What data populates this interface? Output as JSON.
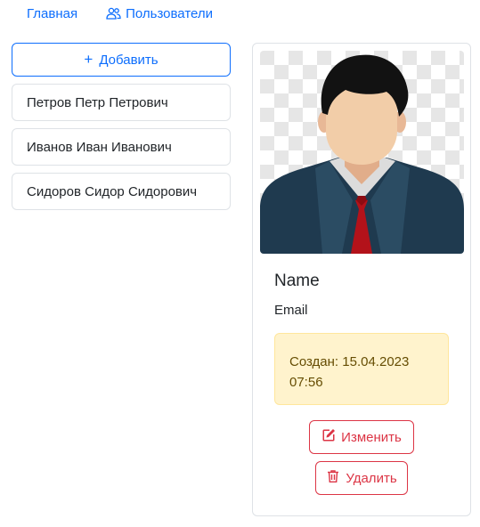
{
  "nav": {
    "home_label": "Главная",
    "users_label": "Пользователи"
  },
  "sidebar": {
    "add_label": "Добавить",
    "users": [
      {
        "name": "Петров Петр Петрович"
      },
      {
        "name": "Иванов Иван Иванович"
      },
      {
        "name": "Сидоров Сидор Сидорович"
      }
    ]
  },
  "card": {
    "name": "Name",
    "email": "Email",
    "created_line1": "Создан: 15.04.2023",
    "created_line2": "07:56",
    "edit_label": "Изменить",
    "delete_label": "Удалить"
  },
  "colors": {
    "primary": "#0d6efd",
    "danger": "#dc3545",
    "warning_bg": "#fff3cd",
    "warning_text": "#664d03"
  },
  "icons": [
    "people-icon",
    "plus-icon",
    "avatar-image",
    "pencil-square-icon",
    "trash-icon"
  ]
}
